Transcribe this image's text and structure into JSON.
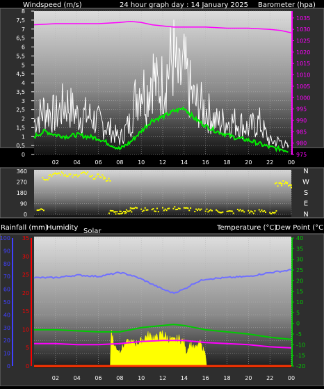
{
  "header": {
    "left_title": "Windspeed (m/s)",
    "center_title": "24 hour graph day : 14 January 2025",
    "right_title": "Barometer (hpa)"
  },
  "bottom_header": {
    "rainfall": "Rainfall (mm)",
    "humidity": "Humidity",
    "solar": "Solar",
    "temperature": "Temperature (°C)",
    "dewpoint": "Dew Point (°C)"
  },
  "colors": {
    "wind_gust": "#ffffff",
    "wind_avg": "#00ee00",
    "barometer": "#ff00ff",
    "direction": "#ffff00",
    "humidity": "#7070ff",
    "temperature": "#00cc00",
    "dewpoint": "#ff00ff",
    "solar": "#ffff00",
    "rain": "#ff3300",
    "left_axis_humidity": "#4040ff",
    "left_axis_rain": "#ff0000",
    "temp_axis": "#00cc00",
    "baro_axis": "#ff00ff"
  },
  "chart_data": [
    {
      "type": "line",
      "title": "24 hour graph day : 14 January 2025",
      "xlabel": "",
      "x_ticks": [
        "02",
        "04",
        "06",
        "08",
        "10",
        "12",
        "14",
        "16",
        "18",
        "20",
        "22",
        "00"
      ],
      "x_range_hours": [
        0,
        24
      ],
      "ylabel": "Windspeed (m/s)",
      "ylim": [
        0,
        8
      ],
      "y_ticks": [
        "0",
        "0,5",
        "1",
        "1,5",
        "2",
        "2,5",
        "3",
        "3,5",
        "4",
        "4,5",
        "5",
        "5,5",
        "6",
        "6,5",
        "7",
        "7,5",
        "8"
      ],
      "y2label": "Barometer (hpa)",
      "y2lim": [
        975,
        1038
      ],
      "y2_ticks": [
        "975",
        "980",
        "985",
        "990",
        "995",
        "1000",
        "1005",
        "1010",
        "1015",
        "1020",
        "1025",
        "1030",
        "1035"
      ],
      "series": [
        {
          "name": "Windspeed (m/s)",
          "axis": "left",
          "hours": [
            0,
            1,
            2,
            3,
            4,
            5,
            6,
            7,
            8,
            9,
            9.5,
            10,
            10.5,
            11,
            11.5,
            12,
            12.5,
            13,
            13.5,
            14,
            14.5,
            15,
            16,
            17,
            18,
            19,
            20,
            21,
            22,
            23,
            23.8
          ],
          "values": [
            2.5,
            3.5,
            3.0,
            4.0,
            3.0,
            3.0,
            2.5,
            2.0,
            1.2,
            2.5,
            4.5,
            5.5,
            4.5,
            6.5,
            5.0,
            5.5,
            6.5,
            7.5,
            5.5,
            6.5,
            5.0,
            4.0,
            3.5,
            2.5,
            2.5,
            2.5,
            2.0,
            2.5,
            1.0,
            1.0,
            0.5
          ]
        },
        {
          "name": "Windspeed average",
          "axis": "left",
          "hours": [
            0,
            1,
            2,
            3,
            4,
            5,
            6,
            7,
            8,
            9,
            10,
            11,
            12,
            13,
            14,
            15,
            16,
            17,
            18,
            19,
            20,
            21,
            22,
            23,
            23.8
          ],
          "values": [
            1.0,
            1.3,
            1.1,
            1.0,
            1.1,
            1.0,
            0.9,
            0.6,
            0.3,
            0.7,
            1.3,
            1.9,
            2.1,
            2.4,
            2.6,
            2.0,
            1.6,
            1.3,
            1.1,
            0.9,
            0.8,
            0.6,
            0.4,
            0.3,
            0.2
          ]
        },
        {
          "name": "Barometer (hpa)",
          "axis": "right",
          "hours": [
            0,
            2,
            4,
            6,
            8,
            9,
            10,
            11,
            12,
            13,
            14,
            16,
            18,
            20,
            22,
            23,
            24
          ],
          "values": [
            1032,
            1032.5,
            1032.5,
            1032.5,
            1033,
            1033.5,
            1033,
            1032,
            1031.5,
            1031,
            1031,
            1031,
            1030.5,
            1030.5,
            1030,
            1029.5,
            1028.5
          ]
        }
      ]
    },
    {
      "type": "scatter",
      "title": "",
      "ylabel": "",
      "ylim": [
        0,
        360
      ],
      "y_ticks": [
        "0",
        "90",
        "180",
        "270",
        "360"
      ],
      "direction_labels": [
        "N",
        "W",
        "S",
        "E",
        "N"
      ],
      "series": [
        {
          "name": "Wind direction",
          "hours": [
            0.3,
            0.8,
            1.4,
            2.1,
            2.8,
            3.6,
            4.4,
            5.2,
            5.9,
            6.5,
            7.0,
            7.5,
            8.0,
            8.5,
            9.0,
            10,
            11,
            12,
            13,
            14,
            15,
            16,
            17,
            18,
            19,
            20,
            21,
            22,
            22.5,
            23,
            23.5,
            24
          ],
          "values": [
            45,
            300,
            330,
            340,
            330,
            320,
            340,
            310,
            320,
            290,
            20,
            15,
            20,
            25,
            60,
            40,
            35,
            45,
            50,
            45,
            30,
            35,
            25,
            20,
            30,
            20,
            25,
            15,
            250,
            270,
            250,
            220
          ]
        }
      ]
    },
    {
      "type": "line",
      "title": "",
      "xlabel": "",
      "x_ticks": [
        "02",
        "04",
        "06",
        "08",
        "10",
        "12",
        "14",
        "16",
        "18",
        "20",
        "22",
        "00"
      ],
      "x_range_hours": [
        0,
        24
      ],
      "ylabel": "Humidity",
      "ylim": [
        0,
        100
      ],
      "y_ticks": [
        "0",
        "10",
        "20",
        "30",
        "40",
        "50",
        "60",
        "70",
        "80",
        "90",
        "100"
      ],
      "rain_label": "Rainfall (mm)",
      "rain_ylim": [
        0,
        35
      ],
      "rain_ticks": [
        "0",
        "5",
        "10",
        "15",
        "20",
        "25",
        "30",
        "35"
      ],
      "y2label": "Temperature (°C)",
      "y2lim": [
        -20,
        40
      ],
      "y2_ticks": [
        "-20",
        "-15",
        "-10",
        "-5",
        "0",
        "5",
        "10",
        "15",
        "20",
        "25",
        "30",
        "35",
        "40"
      ],
      "series": [
        {
          "name": "Humidity",
          "axis": "left",
          "hours": [
            0,
            2,
            4,
            6,
            8,
            9,
            10,
            11,
            12,
            13,
            14,
            15,
            16,
            18,
            20,
            22,
            24
          ],
          "values": [
            69,
            69,
            71,
            70,
            73,
            71,
            68,
            64,
            60,
            57,
            60,
            65,
            68,
            69,
            70,
            73,
            75
          ]
        },
        {
          "name": "Temperature (°C)",
          "axis": "right",
          "hours": [
            0,
            2,
            4,
            6,
            8,
            9,
            10,
            11,
            12,
            13,
            14,
            15,
            16,
            18,
            20,
            22,
            24
          ],
          "values": [
            -3,
            -3,
            -3.5,
            -4,
            -4,
            -3,
            -2,
            -1.5,
            -1,
            -0.5,
            -1,
            -2,
            -3,
            -4,
            -5,
            -6.5,
            -7.5
          ]
        },
        {
          "name": "Dew Point (°C)",
          "axis": "right",
          "hours": [
            0,
            2,
            4,
            6,
            8,
            10,
            12,
            14,
            16,
            18,
            20,
            22,
            24
          ],
          "values": [
            -9.5,
            -9.5,
            -10,
            -10,
            -9.5,
            -8.5,
            -8,
            -8,
            -9,
            -9.5,
            -10,
            -11,
            -11.5
          ]
        },
        {
          "name": "Solar",
          "axis": "left",
          "hours": [
            7.1,
            7.2,
            7.4,
            7.6,
            8,
            8.5,
            9,
            9.5,
            10,
            10.5,
            11,
            11.5,
            12,
            12.5,
            13,
            13.5,
            14,
            14.2,
            14.5,
            15,
            15.5,
            16,
            16.1
          ],
          "values": [
            0,
            33,
            18,
            15,
            12,
            18,
            19,
            18,
            20,
            24,
            24,
            22,
            26,
            22,
            20,
            22,
            19,
            10,
            18,
            14,
            18,
            10,
            0
          ]
        },
        {
          "name": "Rainfall (mm)",
          "axis": "left",
          "hours": [
            0,
            24
          ],
          "values": [
            0,
            0
          ]
        }
      ]
    }
  ]
}
